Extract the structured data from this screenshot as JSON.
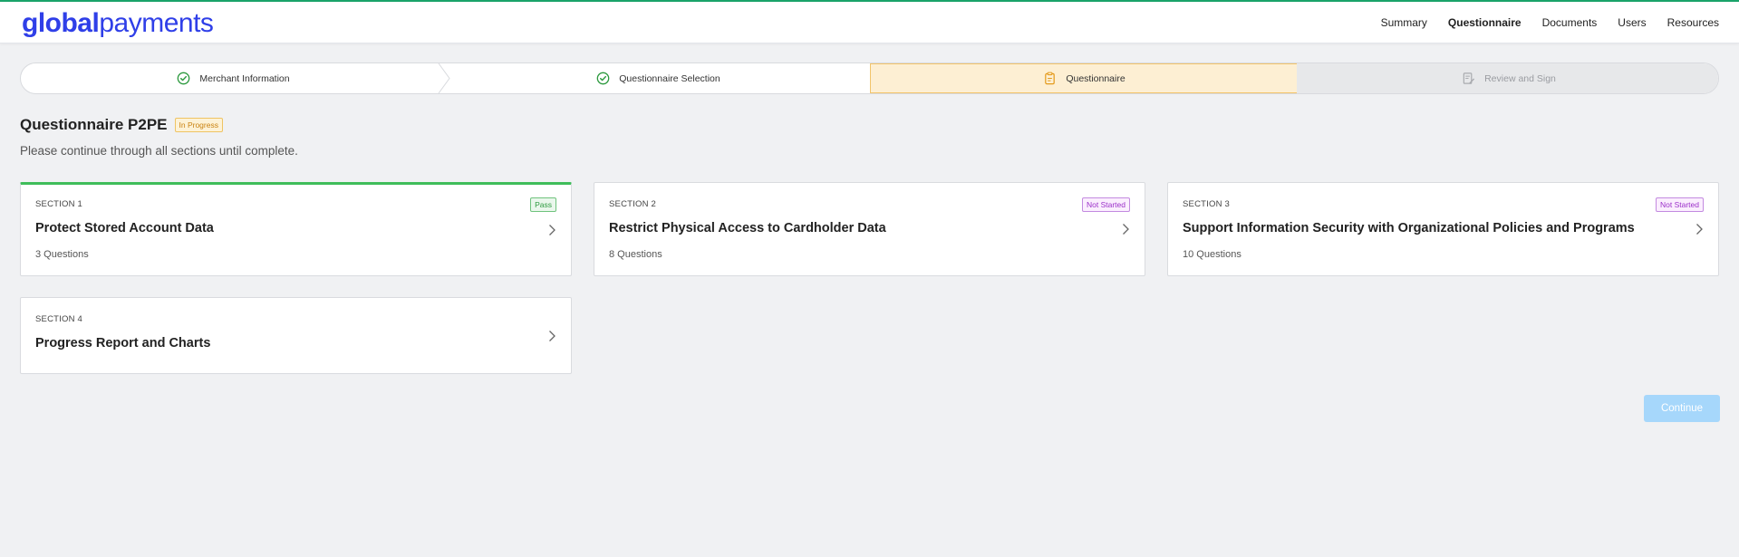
{
  "brand": {
    "logo_part1": "global",
    "logo_part2": "payments",
    "accent": "#2f3fe8"
  },
  "nav": {
    "items": [
      {
        "label": "Summary",
        "active": false
      },
      {
        "label": "Questionnaire",
        "active": true
      },
      {
        "label": "Documents",
        "active": false
      },
      {
        "label": "Users",
        "active": false
      },
      {
        "label": "Resources",
        "active": false
      }
    ]
  },
  "stepper": {
    "steps": [
      {
        "label": "Merchant Information",
        "state": "complete",
        "icon": "check-circle-icon"
      },
      {
        "label": "Questionnaire Selection",
        "state": "complete",
        "icon": "check-circle-icon"
      },
      {
        "label": "Questionnaire",
        "state": "current",
        "icon": "clipboard-icon"
      },
      {
        "label": "Review and Sign",
        "state": "upcoming",
        "icon": "sign-document-icon"
      }
    ]
  },
  "page": {
    "title": "Questionnaire P2PE",
    "status_badge": "In Progress",
    "subtitle": "Please continue through all sections until complete."
  },
  "sections": [
    {
      "section": "SECTION 1",
      "title": "Protect Stored Account Data",
      "questions": "3 Questions",
      "badge": "Pass"
    },
    {
      "section": "SECTION 2",
      "title": "Restrict Physical Access to Cardholder Data",
      "questions": "8 Questions",
      "badge": "Not Started"
    },
    {
      "section": "SECTION 3",
      "title": "Support Information Security with Organizational Policies and Programs",
      "questions": "10 Questions",
      "badge": "Not Started"
    },
    {
      "section": "SECTION 4",
      "title": "Progress Report and Charts"
    }
  ],
  "actions": {
    "continue_label": "Continue"
  },
  "colors": {
    "pass": "#2d9a3f",
    "in_progress": "#c98211",
    "not_started": "#9b2fc9",
    "current_step_bg": "#fdefd3",
    "continue_disabled": "#a6d7fb"
  }
}
